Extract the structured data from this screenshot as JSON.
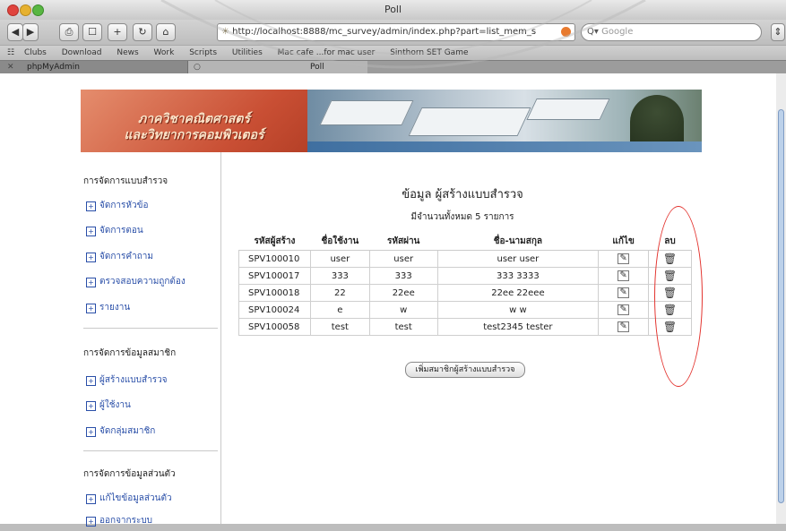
{
  "window": {
    "title": "Poll"
  },
  "toolbar": {
    "url": "http://localhost:8888/mc_survey/admin/index.php?part=list_mem_s",
    "search_placeholder": "Google"
  },
  "bookmarks": [
    "Clubs",
    "Download",
    "News",
    "Work",
    "Scripts",
    "Utilities",
    "Mac cafe ...for mac user",
    "Sinthorn SET Game"
  ],
  "tabs": [
    "phpMyAdmin",
    "Poll"
  ],
  "banner": {
    "line1": "ภาควิชาคณิตศาสตร์",
    "line2": "และวิทยาการคอมพิวเตอร์"
  },
  "sidebar": {
    "section1": {
      "heading": "การจัดการแบบสำรวจ",
      "items": [
        "จัดการหัวข้อ",
        "จัดการตอน",
        "จัดการคำถาม",
        "ตรวจสอบความถูกต้อง",
        "รายงาน"
      ]
    },
    "section2": {
      "heading": "การจัดการข้อมูลสมาชิก",
      "items": [
        "ผู้สร้างแบบสำรวจ",
        "ผู้ใช้งาน",
        "จัดกลุ่มสมาชิก"
      ]
    },
    "section3": {
      "heading": "การจัดการข้อมูลส่วนตัว",
      "items": [
        "แก้ไขข้อมูลส่วนตัว",
        "ออกจากระบบ"
      ]
    }
  },
  "content": {
    "title": "ข้อมูล ผู้สร้างแบบสำรวจ",
    "count": "มีจำนวนทั้งหมด 5 รายการ",
    "headers": [
      "รหัสผู้สร้าง",
      "ชื่อใช้งาน",
      "รหัสผ่าน",
      "ชื่อ-นามสกุล",
      "แก้ไข",
      "ลบ"
    ],
    "rows": [
      {
        "code": "SPV100010",
        "username": "user",
        "password": "user",
        "fullname": "user user"
      },
      {
        "code": "SPV100017",
        "username": "333",
        "password": "333",
        "fullname": "333 3333"
      },
      {
        "code": "SPV100018",
        "username": "22",
        "password": "22ee",
        "fullname": "22ee 22eee"
      },
      {
        "code": "SPV100024",
        "username": "e",
        "password": "w",
        "fullname": "w w"
      },
      {
        "code": "SPV100058",
        "username": "test",
        "password": "test",
        "fullname": "test2345 tester"
      }
    ],
    "add_button": "เพิ่มสมาชิกผู้สร้างแบบสำรวจ"
  },
  "icons": {
    "edit": "edit-icon",
    "delete": "trash-icon"
  },
  "colors": {
    "highlight": "#e3342f",
    "link": "#2a4fa8",
    "banner": "#c94f34"
  }
}
